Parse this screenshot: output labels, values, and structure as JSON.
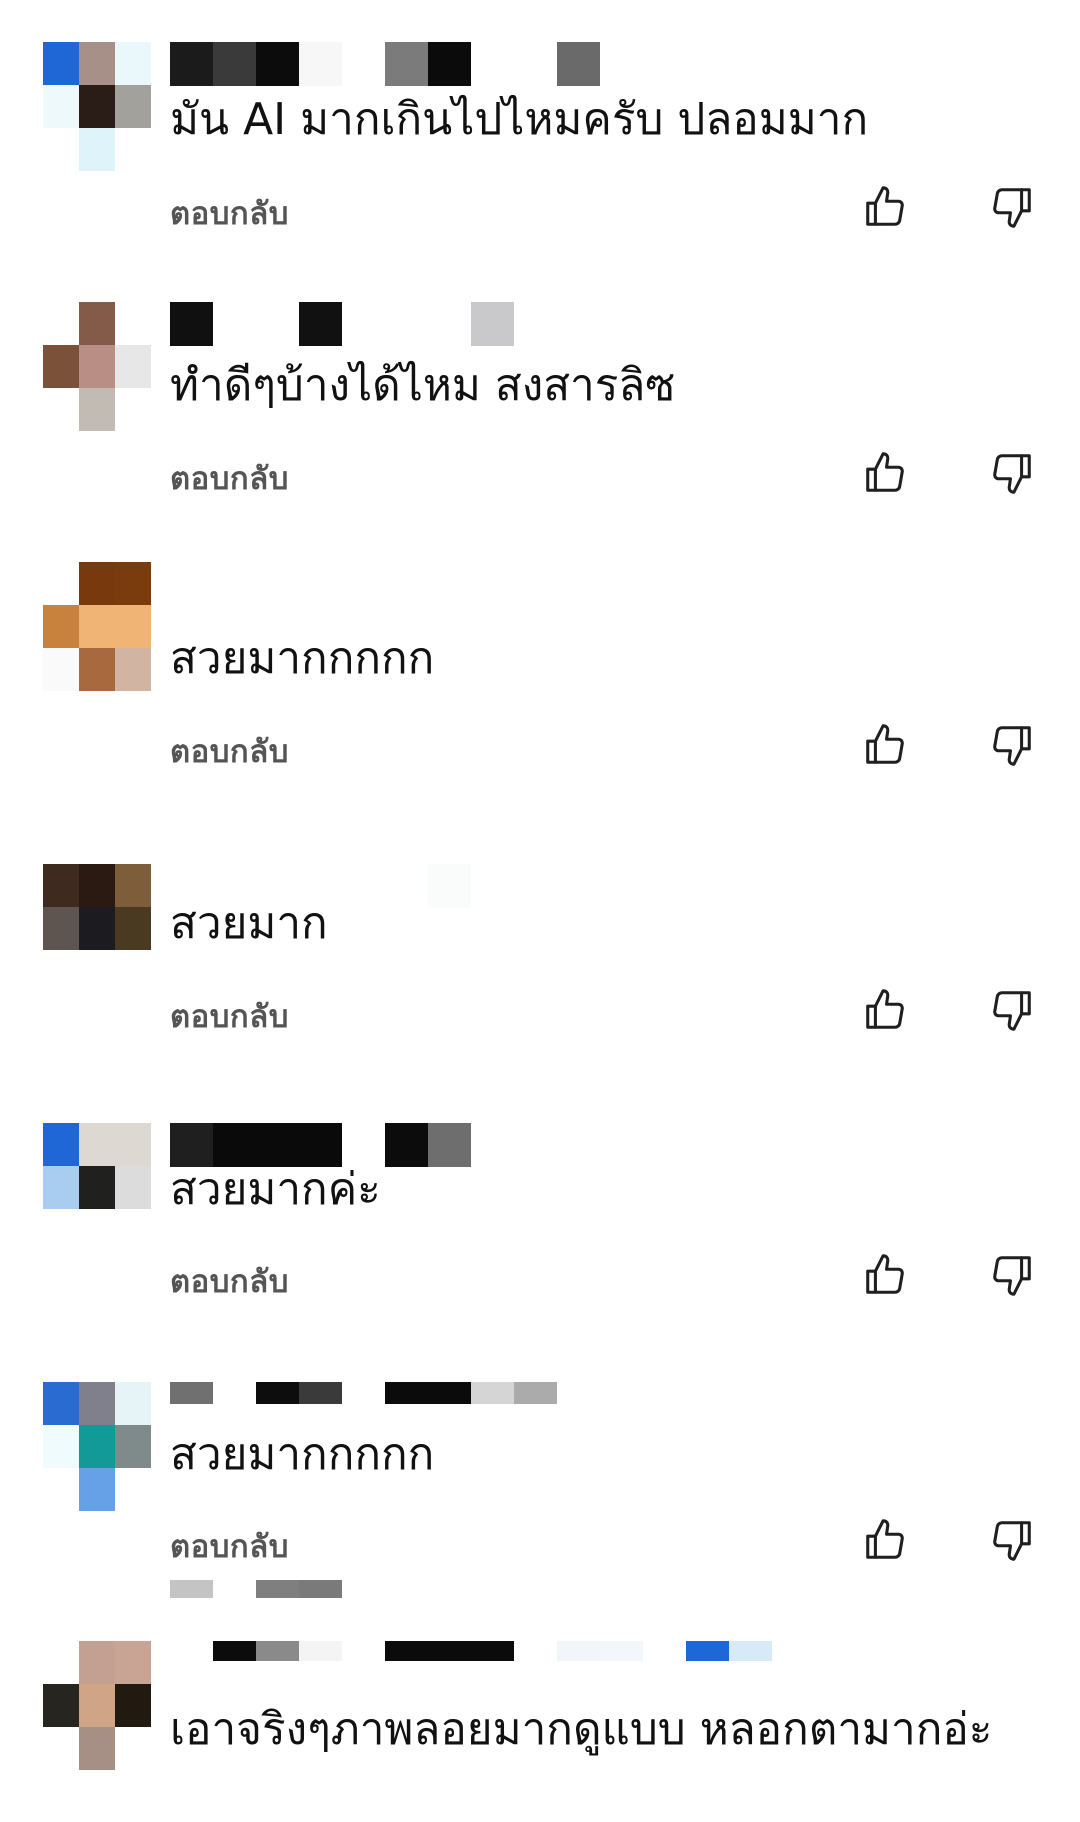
{
  "reply_label": "ตอบกลับ",
  "comments": [
    {
      "text": "มัน AI มากเกินไปไหมครับ ปลอมมาก"
    },
    {
      "text": "ทำดีๆบ้างได้ไหม สงสารลิซ"
    },
    {
      "text": "สวยมากกกกก"
    },
    {
      "text": "สวยมาก"
    },
    {
      "text": "สวยมากค่ะ"
    },
    {
      "text": "สวยมากกกกก"
    },
    {
      "text": "เอาจริงๆภาพลอยมากดูแบบ หลอกตามากอ่ะ"
    }
  ],
  "icons": {
    "like": "thumbs-up-icon",
    "dislike": "thumbs-down-icon"
  },
  "colors": {
    "text": "#111111",
    "reply": "#555555",
    "icon": "#1f1f1f"
  }
}
